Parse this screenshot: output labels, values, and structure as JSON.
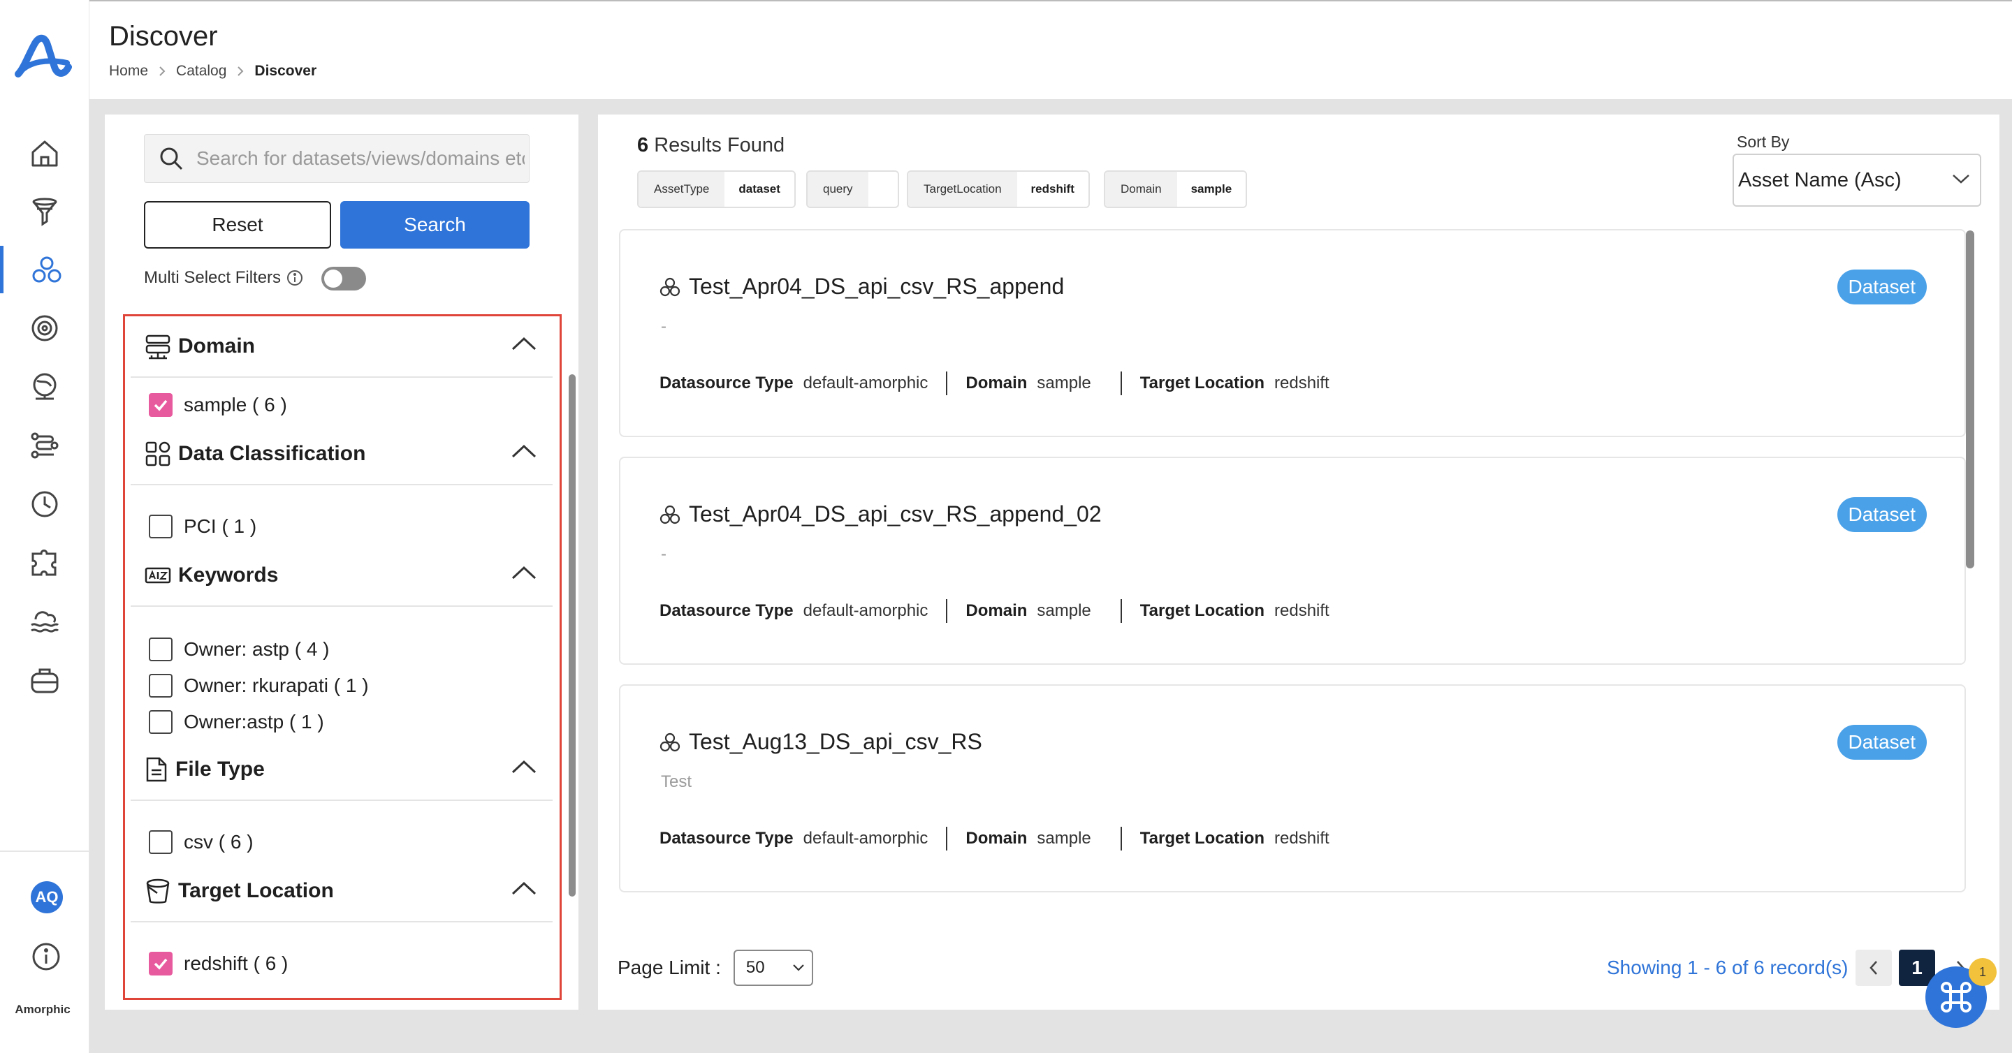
{
  "app": {
    "brand": "Amorphic",
    "user_initials": "AQ"
  },
  "nav": {
    "items": [
      {
        "icon": "home-icon"
      },
      {
        "icon": "funnel-icon"
      },
      {
        "icon": "catalog-icon",
        "active": true
      },
      {
        "icon": "target-icon"
      },
      {
        "icon": "globe-icon"
      },
      {
        "icon": "flow-icon"
      },
      {
        "icon": "clock-icon"
      },
      {
        "icon": "puzzle-icon"
      },
      {
        "icon": "lake-icon"
      },
      {
        "icon": "briefcase-icon"
      }
    ]
  },
  "header": {
    "title": "Discover",
    "breadcrumb": [
      "Home",
      "Catalog",
      "Discover"
    ]
  },
  "filters": {
    "search_placeholder": "Search for datasets/views/domains etc.",
    "reset_label": "Reset",
    "search_label": "Search",
    "multi_select_label": "Multi Select Filters",
    "multi_select_on": false,
    "sections": [
      {
        "title": "Domain",
        "options": [
          {
            "label": "sample ( 6 )",
            "checked": true
          }
        ]
      },
      {
        "title": "Data Classification",
        "options": [
          {
            "label": "PCI ( 1 )",
            "checked": false
          }
        ]
      },
      {
        "title": "Keywords",
        "options": [
          {
            "label": "Owner: astp ( 4 )",
            "checked": false
          },
          {
            "label": "Owner: rkurapati ( 1 )",
            "checked": false
          },
          {
            "label": "Owner:astp ( 1 )",
            "checked": false
          }
        ]
      },
      {
        "title": "File Type",
        "options": [
          {
            "label": "csv ( 6 )",
            "checked": false
          }
        ]
      },
      {
        "title": "Target Location",
        "options": [
          {
            "label": "redshift ( 6 )",
            "checked": true
          }
        ]
      }
    ]
  },
  "results": {
    "count": "6",
    "found_label": "Results Found",
    "chips": [
      {
        "key": "AssetType",
        "value": "dataset"
      },
      {
        "key": "query",
        "value": ""
      },
      {
        "key": "TargetLocation",
        "value": "redshift"
      },
      {
        "key": "Domain",
        "value": "sample"
      }
    ],
    "sort_label": "Sort By",
    "sort_value": "Asset Name (Asc)",
    "meta_labels": {
      "datasource": "Datasource Type",
      "domain": "Domain",
      "target": "Target Location"
    },
    "cards": [
      {
        "name": "Test_Apr04_DS_api_csv_RS_append",
        "desc": "-",
        "badge": "Dataset",
        "datasource": "default-amorphic",
        "domain": "sample",
        "target": "redshift"
      },
      {
        "name": "Test_Apr04_DS_api_csv_RS_append_02",
        "desc": "-",
        "badge": "Dataset",
        "datasource": "default-amorphic",
        "domain": "sample",
        "target": "redshift"
      },
      {
        "name": "Test_Aug13_DS_api_csv_RS",
        "desc": "Test",
        "badge": "Dataset",
        "datasource": "default-amorphic",
        "domain": "sample",
        "target": "redshift"
      }
    ],
    "page_limit_label": "Page Limit :",
    "page_limit_value": "50",
    "showing": "Showing 1 - 6 of 6 record(s)",
    "current_page": "1"
  },
  "fab": {
    "badge": "1"
  },
  "colors": {
    "accent": "#2f74d8",
    "checkbox_checked": "#e85a9e",
    "badge": "#4aa1e8",
    "highlight_border": "#e0453a"
  }
}
